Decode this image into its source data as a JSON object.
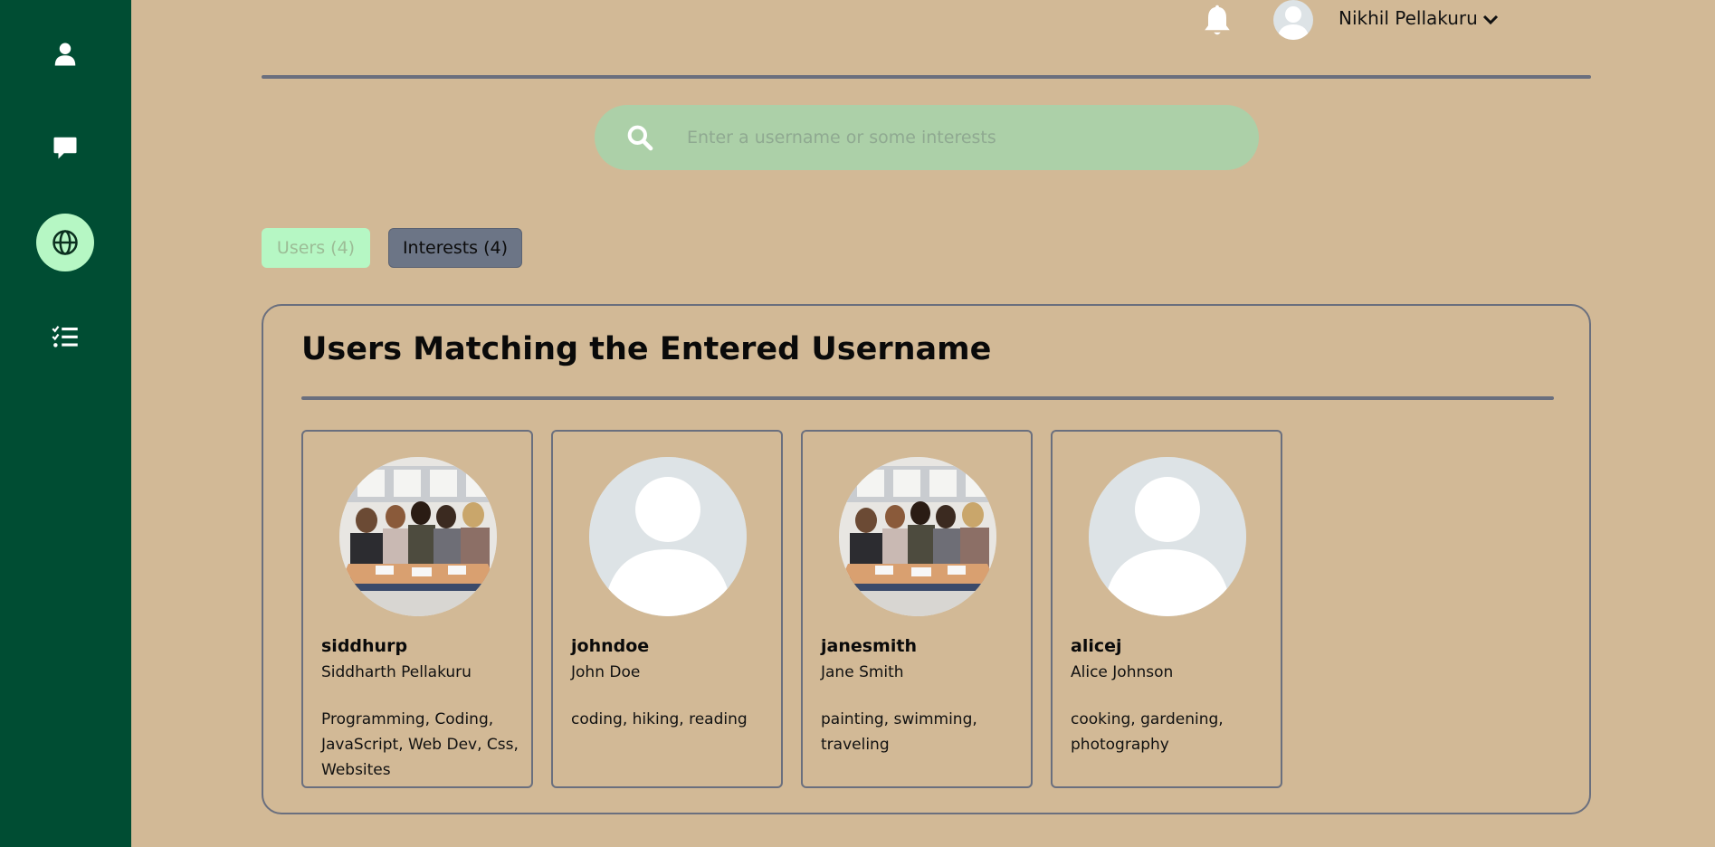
{
  "user": {
    "name": "Nikhil Pellakuru"
  },
  "search": {
    "placeholder": "Enter a username or some interests"
  },
  "tabs": [
    {
      "label": "Users (4)"
    },
    {
      "label": "Interests (4)"
    }
  ],
  "results": {
    "title": "Users Matching the Entered Username",
    "users": [
      {
        "username": "siddhurp",
        "full_name": "Siddharth Pellakuru",
        "interests": "Programming, Coding, JavaScript, Web Dev, Css, Websites",
        "avatar": "group-photo"
      },
      {
        "username": "johndoe",
        "full_name": "John Doe",
        "interests": "coding, hiking, reading",
        "avatar": "default-avatar"
      },
      {
        "username": "janesmith",
        "full_name": "Jane Smith",
        "interests": "painting, swimming, traveling",
        "avatar": "group-photo"
      },
      {
        "username": "alicej",
        "full_name": "Alice Johnson",
        "interests": "cooking, gardening, photography",
        "avatar": "default-avatar"
      }
    ]
  },
  "sidebar": {
    "items": [
      {
        "icon": "user-icon"
      },
      {
        "icon": "chat-icon"
      },
      {
        "icon": "globe-icon",
        "active": true
      },
      {
        "icon": "checklist-icon"
      }
    ]
  },
  "colors": {
    "background": "#d2b996",
    "sidebar": "#004d33",
    "accent": "#b6f7c4",
    "search": "#acd0a8",
    "border": "#6a6f7e"
  }
}
